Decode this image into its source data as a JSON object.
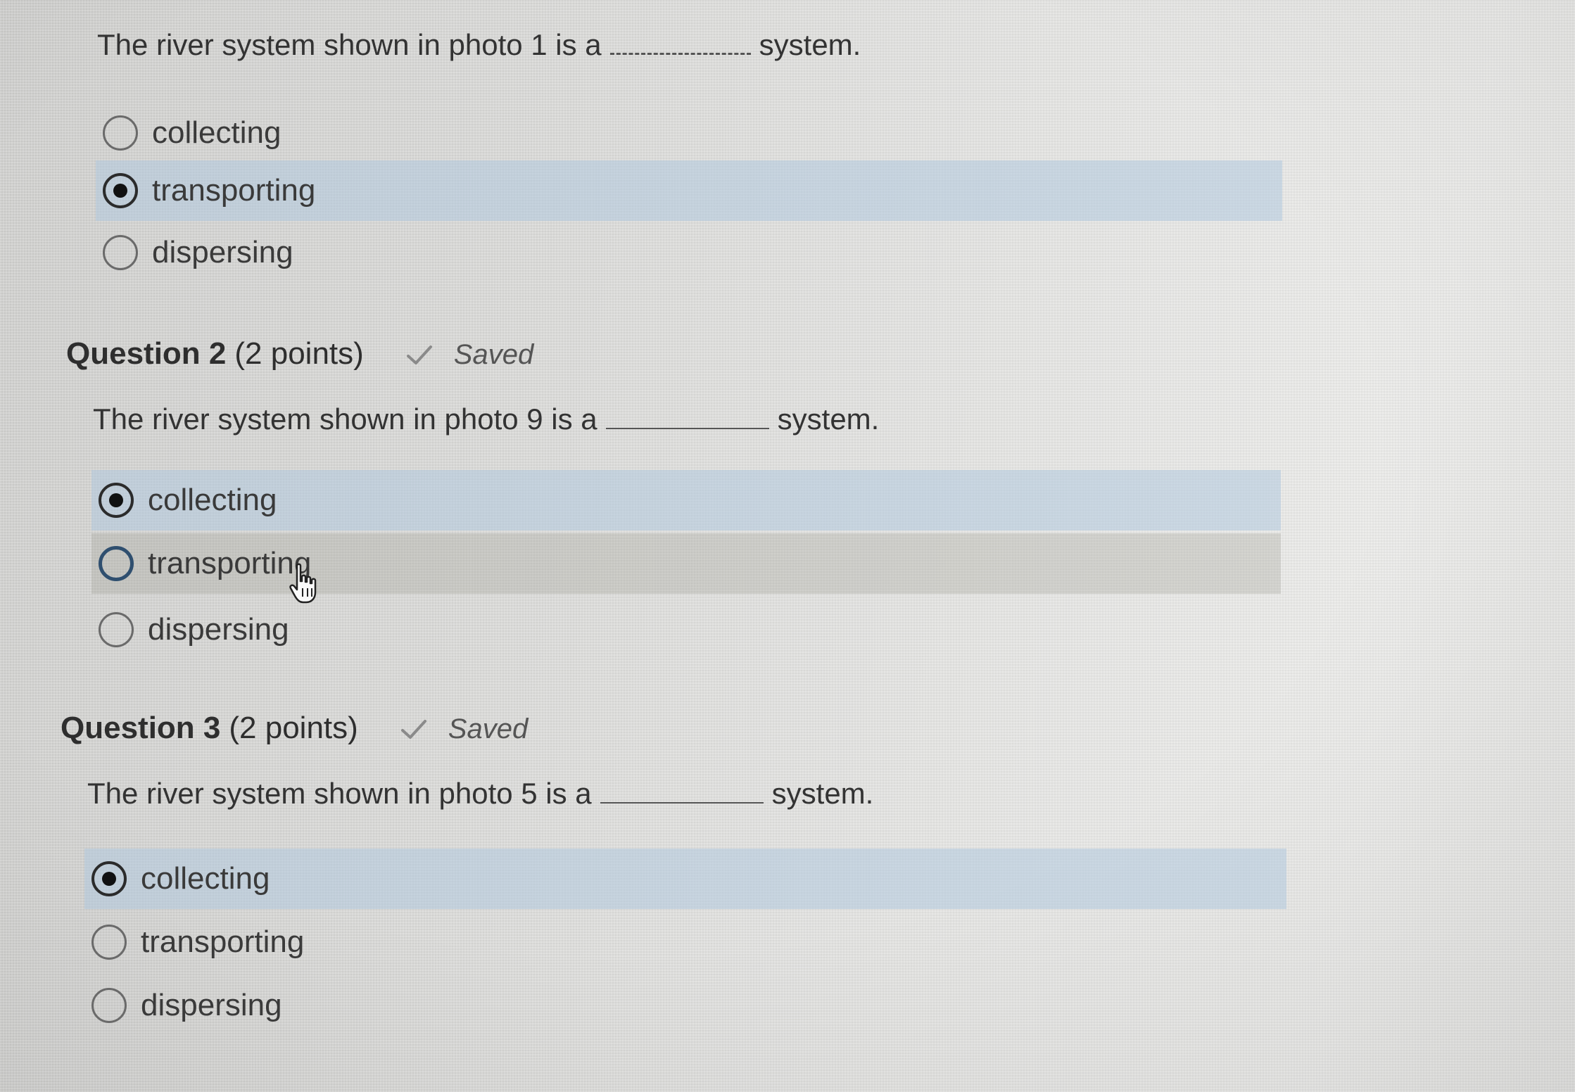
{
  "questions": [
    {
      "prompt_before": "The river system shown in photo 1 is a",
      "prompt_after": "system.",
      "options": [
        "collecting",
        "transporting",
        "dispersing"
      ],
      "selected": 1
    },
    {
      "title": "Question 2",
      "points": "(2 points)",
      "status": "Saved",
      "prompt_before": "The river system shown in photo 9 is a",
      "prompt_after": "system.",
      "options": [
        "collecting",
        "transporting",
        "dispersing"
      ],
      "selected": 0,
      "hovered": 1
    },
    {
      "title": "Question 3",
      "points": "(2 points)",
      "status": "Saved",
      "prompt_before": "The river system shown in photo 5 is a",
      "prompt_after": "system.",
      "options": [
        "collecting",
        "transporting",
        "dispersing"
      ],
      "selected": 0
    }
  ],
  "icons": {
    "saved": "check-icon",
    "pointer": "hand-pointer-icon"
  },
  "colors": {
    "selected_row": "#b0c8de",
    "hover_row": "#a0a096"
  }
}
